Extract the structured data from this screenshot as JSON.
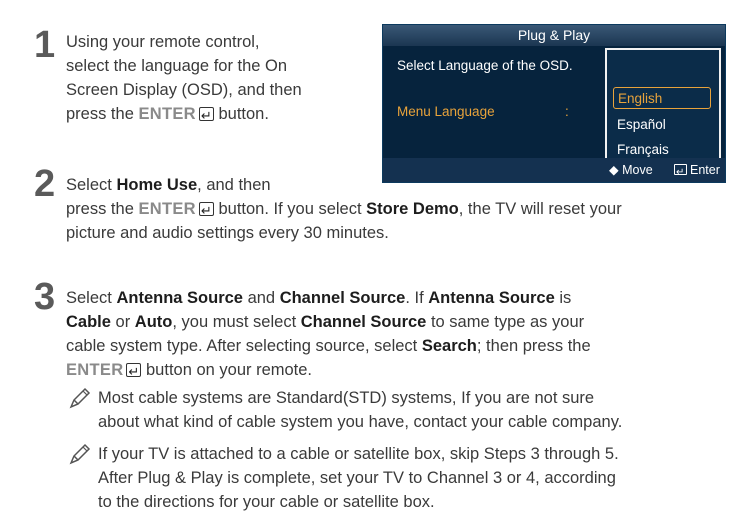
{
  "step1": {
    "number": "1",
    "lines": [
      "Using your remote control,",
      "select the language for the On",
      "Screen Display (OSD), and then"
    ],
    "line4_pre": "press the ",
    "enter": "ENTER",
    "line4_post": " button."
  },
  "osd": {
    "title": "Plug & Play",
    "prompt": "Select Language of the OSD.",
    "menu_label": "Menu Language",
    "colon": ":",
    "languages": [
      "English",
      "Español",
      "Français"
    ],
    "selected_language": "English",
    "footer_move": "Move",
    "footer_enter": "Enter"
  },
  "step2": {
    "number": "2",
    "line1_pre": "Select ",
    "home_use": "Home Use",
    "line1_post": ", and then",
    "line2_pre": "press the ",
    "enter": "ENTER",
    "line2_mid": " button. If you select ",
    "store_demo": "Store Demo",
    "line2_post": ", the TV will reset your",
    "line3": "picture and audio settings every 30 minutes."
  },
  "step3": {
    "number": "3",
    "l1_a": "Select ",
    "antenna_source": "Antenna Source",
    "l1_b": " and ",
    "channel_source": "Channel Source",
    "l1_c": ". If ",
    "l1_d": " is",
    "cable": "Cable",
    "l2_b": " or ",
    "auto": "Auto",
    "l2_c": ", you must select ",
    "l2_d": " to same type as your",
    "l3_a": "cable system type. After selecting source, select ",
    "search": "Search",
    "l3_b": "; then press the",
    "enter": "ENTER",
    "l4_b": " button on your remote."
  },
  "notes": [
    {
      "lines": [
        "Most cable systems are Standard(STD) systems, If you are not sure",
        "about what kind of cable system you have, contact your cable company."
      ]
    },
    {
      "lines": [
        "If your TV is attached to a cable or satellite box, skip Steps 3 through 5.",
        "After Plug & Play is complete, set your TV to Channel 3 or 4, according",
        "to the directions for your cable or satellite box."
      ]
    }
  ]
}
